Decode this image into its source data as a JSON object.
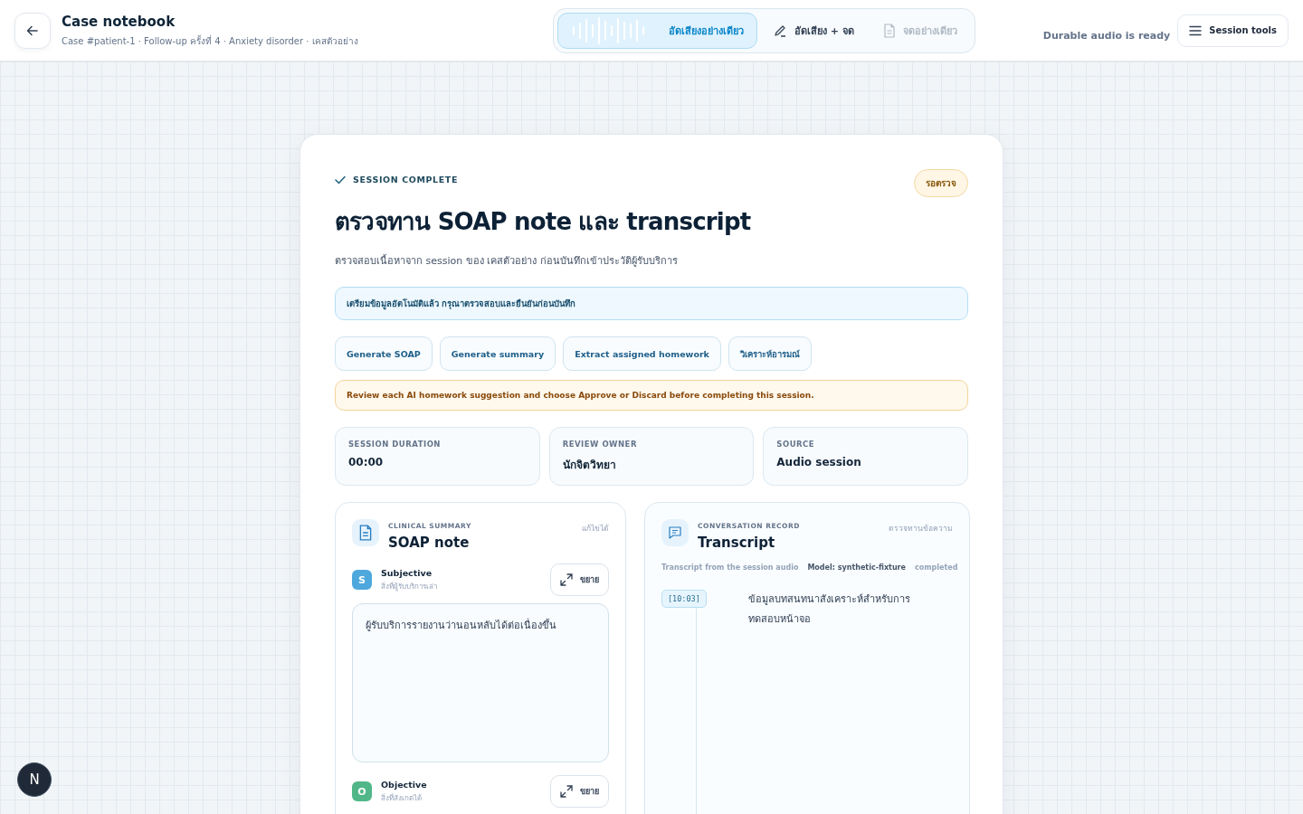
{
  "header": {
    "title": "Case notebook",
    "subtitle": "Case #patient-1 · Follow-up ครั้งที่ 4 · Anxiety disorder · เคสตัวอย่าง"
  },
  "modes": [
    {
      "kind": "audio",
      "label": "อัดเสียงอย่างเดียว",
      "selected": true,
      "disabled": false
    },
    {
      "kind": "pen",
      "label": "อัดเสียง + จด",
      "selected": false,
      "disabled": false
    },
    {
      "kind": "doc",
      "label": "จดอย่างเดียว",
      "selected": false,
      "disabled": true
    }
  ],
  "status": "Durable audio is ready",
  "tools_button": "Session tools",
  "card": {
    "eyebrow": "SESSION COMPLETE",
    "badge": "รอตรวจ",
    "title": "ตรวจทาน SOAP note และ transcript",
    "description": "ตรวจสอบเนื้อหาจาก session ของ เคสตัวอย่าง ก่อนบันทึกเข้าประวัติผู้รับบริการ",
    "info": "เตรียมข้อมูลอัตโนมัติแล้ว กรุณาตรวจสอบและยืนยันก่อนบันทึก",
    "actions": [
      "Generate SOAP",
      "Generate summary",
      "Extract assigned homework",
      "วิเคราะห์อารมณ์"
    ],
    "warning": "Review each AI homework suggestion and choose Approve or Discard before completing this session.",
    "stats": [
      {
        "label": "SESSION DURATION",
        "value": "00:00"
      },
      {
        "label": "REVIEW OWNER",
        "value": "นักจิตวิทยา"
      },
      {
        "label": "SOURCE",
        "value": "Audio session"
      }
    ]
  },
  "soap": {
    "eyebrow": "CLINICAL SUMMARY",
    "title": "SOAP note",
    "hint": "แก้ไขได้",
    "sections": [
      {
        "letter": "S",
        "color": "#4ea8dd",
        "title": "Subjective",
        "subtitle": "สิ่งที่ผู้รับบริการเล่า",
        "expand": "ขยาย",
        "value": "ผู้รับบริการรายงานว่านอนหลับได้ต่อเนื่องขึ้น"
      },
      {
        "letter": "O",
        "color": "#52b788",
        "title": "Objective",
        "subtitle": "สิ่งที่สังเกตได้",
        "expand": "ขยาย"
      }
    ]
  },
  "transcript": {
    "eyebrow": "CONVERSATION RECORD",
    "title": "Transcript",
    "hint": "ตรวจทานข้อความ",
    "source": "Transcript from the session audio",
    "model": "Model: synthetic-fixture",
    "state": "completed",
    "segments": [
      {
        "time": "[10:03]",
        "text": "ข้อมูลบทสนทนาสังเคราะห์สำหรับการทดสอบหน้าจอ"
      }
    ]
  },
  "dev_badge": "N"
}
